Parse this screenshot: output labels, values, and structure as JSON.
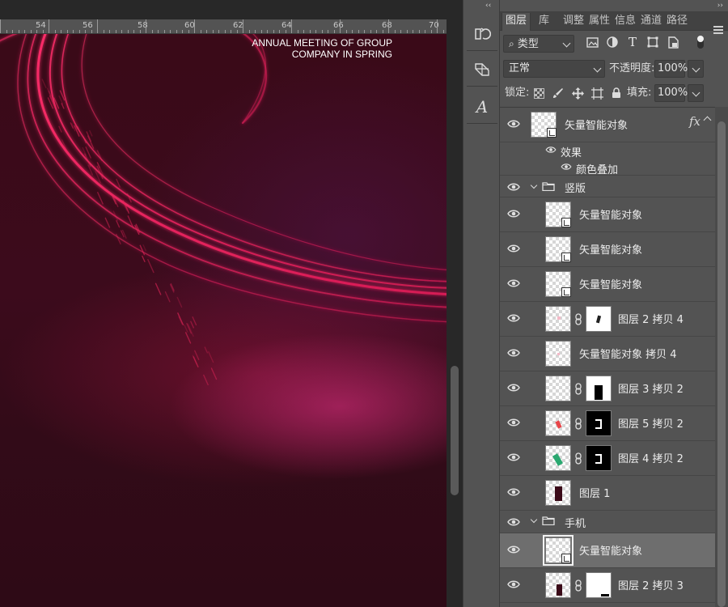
{
  "poster": {
    "line1": "ANNUAL MEETING OF GROUP",
    "line2": "COMPANY IN SPRING"
  },
  "ruler": {
    "labels": [
      "54",
      "56",
      "58",
      "60",
      "62",
      "64",
      "66",
      "68",
      "70"
    ]
  },
  "tools": [
    {
      "name": "history-brush-icon"
    },
    {
      "name": "3d-layers-icon"
    },
    {
      "name": "glyph-a-icon"
    }
  ],
  "tabs": [
    "图层",
    "库",
    "调整",
    "属性",
    "信息",
    "通道",
    "路径"
  ],
  "filter": {
    "kind_label": "类型",
    "icons": [
      "image-filter-icon",
      "adjustment-filter-icon",
      "type-filter-icon",
      "shape-filter-icon",
      "smart-object-filter-icon",
      "filter-toggle-icon"
    ]
  },
  "blend": {
    "mode": "正常",
    "opacity_label": "不透明度:",
    "opacity_value": "100%"
  },
  "lock": {
    "label": "锁定:",
    "fill_label": "填充:",
    "fill_value": "100%",
    "icons": [
      "lock-transparency-icon",
      "lock-brush-icon",
      "lock-move-icon",
      "lock-artboard-icon",
      "lock-all-icon"
    ]
  },
  "layers": {
    "top_layer": {
      "name": "矢量智能对象",
      "fx": "fx"
    },
    "effects_label": "效果",
    "color_overlay": "颜色叠加",
    "group1": "竖版",
    "items": [
      {
        "name": "矢量智能对象"
      },
      {
        "name": "矢量智能对象"
      },
      {
        "name": "矢量智能对象"
      },
      {
        "name": "图层 2 拷贝 4"
      },
      {
        "name": "矢量智能对象 拷贝 4"
      },
      {
        "name": "图层 3 拷贝 2"
      },
      {
        "name": "图层 5 拷贝 2"
      },
      {
        "name": "图层 4 拷贝 2"
      },
      {
        "name": "图层 1"
      }
    ],
    "group2": "手机",
    "group2_items": [
      {
        "name": "矢量智能对象",
        "selected": true
      },
      {
        "name": "图层 2 拷贝 3"
      }
    ]
  },
  "colors": {
    "accent": "#e8265a",
    "background": "#3a0a18",
    "panel": "#535353"
  }
}
